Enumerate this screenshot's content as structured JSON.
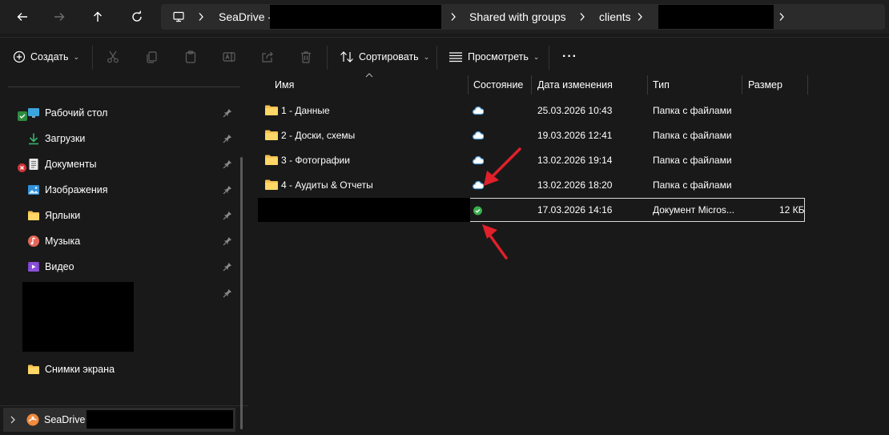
{
  "address_bar": {
    "segments": [
      "SeaDrive -",
      "Shared with groups",
      "clients"
    ]
  },
  "toolbar": {
    "create_label": "Создать",
    "sort_label": "Сортировать",
    "view_label": "Просмотреть",
    "more_label": "···"
  },
  "sidebar": {
    "items": [
      {
        "label": "Рабочий стол",
        "icon": "desktop-icon"
      },
      {
        "label": "Загрузки",
        "icon": "downloads-icon"
      },
      {
        "label": "Документы",
        "icon": "documents-icon"
      },
      {
        "label": "Изображения",
        "icon": "pictures-icon"
      },
      {
        "label": "Ярлыки",
        "icon": "folder-icon"
      },
      {
        "label": "Музыка",
        "icon": "music-icon"
      },
      {
        "label": "Видео",
        "icon": "video-icon"
      },
      {
        "label": "Снимки экрана",
        "icon": "folder-icon"
      }
    ],
    "drive_label": "SeaDrive -"
  },
  "columns": {
    "name": "Имя",
    "status": "Состояние",
    "date": "Дата изменения",
    "type": "Тип",
    "size": "Размер"
  },
  "rows": [
    {
      "name": "1 - Данные",
      "status": "cloud",
      "date": "25.03.2026 10:43",
      "type": "Папка с файлами",
      "size": ""
    },
    {
      "name": "2 - Доски, схемы",
      "status": "cloud",
      "date": "19.03.2026 12:41",
      "type": "Папка с файлами",
      "size": ""
    },
    {
      "name": "3 - Фотографии",
      "status": "cloud",
      "date": "13.02.2026 19:14",
      "type": "Папка с файлами",
      "size": ""
    },
    {
      "name": "4 - Аудиты & Отчеты",
      "status": "cloud",
      "date": "13.02.2026 18:20",
      "type": "Папка с файлами",
      "size": ""
    },
    {
      "name": "",
      "status": "synced",
      "date": "17.03.2026 14:16",
      "type": "Документ Micros...",
      "size": "12 КБ"
    }
  ],
  "colors": {
    "background": "#191919",
    "folder": "#f4c04f",
    "cloud": "#5aa8e6",
    "synced": "#3aaf4f",
    "arrow": "#e0202a"
  }
}
